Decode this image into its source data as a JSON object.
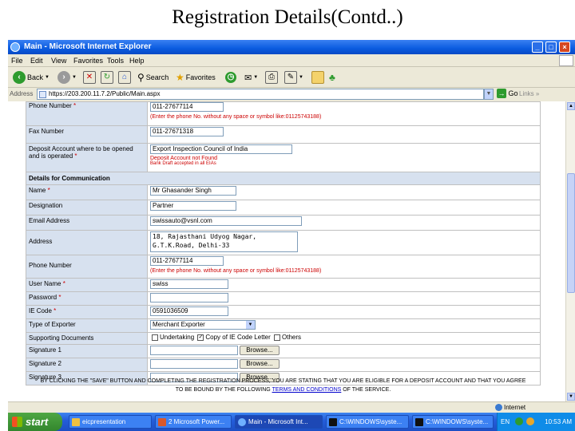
{
  "slide": {
    "title": "Registration Details(Contd..)"
  },
  "window": {
    "title": "Main - Microsoft Internet Explorer",
    "minimize": "_",
    "maximize": "□",
    "close": "×"
  },
  "menu": [
    "File",
    "Edit",
    "View",
    "Favorites",
    "Tools",
    "Help"
  ],
  "toolbar": {
    "back": "Back",
    "search": "Search",
    "favorites": "Favorites"
  },
  "address": {
    "label": "Address",
    "url": "https://203.200.11.7.2/Public/Main.aspx",
    "go": "Go",
    "links": "Links"
  },
  "form": {
    "rows_top": [
      {
        "label": "Phone Number",
        "required": "*",
        "value": "011-27677114",
        "hint": "(Enter the phone No. without any space or symbol like:01125743188)"
      },
      {
        "label": "Fax Number",
        "required": "",
        "value": "011-27671318",
        "hint": ""
      },
      {
        "label": "Deposit Account where to be opened and is operated",
        "required": "*",
        "value": "Export Inspection Council of India",
        "hint": "Deposit Account not Found",
        "hint2": "Bank Draft accepted in all EIAs"
      }
    ],
    "section": "Details for Communication",
    "name": {
      "label": "Name",
      "required": "*",
      "value": "Mr Ghasander Singh"
    },
    "designation": {
      "label": "Designation",
      "value": "Partner"
    },
    "email": {
      "label": "Email Address",
      "value": "swissauto@vsnl.com"
    },
    "address": {
      "label": "Address",
      "line1": "18, Rajasthani Udyog Nagar,",
      "line2": "G.T.K.Road, Delhi-33"
    },
    "phone": {
      "label": "Phone Number",
      "value": "011-27677114",
      "hint": "(Enter the phone No. without any space or symbol like:01125743188)"
    },
    "username": {
      "label": "User Name",
      "required": "*",
      "value": "swiss"
    },
    "password": {
      "label": "Password",
      "required": "*",
      "value": ""
    },
    "iecode": {
      "label": "IE Code",
      "required": "*",
      "value": "0591036509"
    },
    "exporter": {
      "label": "Type of Exporter",
      "value": "Merchant Exporter"
    },
    "docs": {
      "label": "Supporting Documents",
      "opt1": "Undertaking",
      "opt2": "Copy of IE Code Letter",
      "opt3": "Others",
      "checkmark": "✓"
    },
    "sig1": {
      "label": "Signature 1",
      "button": "Browse..."
    },
    "sig2": {
      "label": "Signature 2",
      "button": "Browse..."
    },
    "sig3": {
      "label": "Signature 3",
      "button": "Browse..."
    }
  },
  "note": {
    "line1": "BY CLICKING THE \"SAVE\" BUTTON AND COMPLETING THE REGISTRATION PROCESS, YOU ARE STATING THAT YOU ARE ELIGIBLE FOR A DEPOSIT ACCOUNT AND THAT YOU AGREE",
    "line2a": "TO BE BOUND BY THE FOLLOWING ",
    "link": "TERMS AND CONDITIONS",
    "line2b": " OF THE SERVICE."
  },
  "status": {
    "zone": "Internet"
  },
  "taskbar": {
    "start": "start",
    "tasks": [
      "eicpresentation",
      "2 Microsoft Power...",
      "Main - Microsoft Int...",
      "C:\\WINDOWS\\syste...",
      "C:\\WINDOWS\\syste..."
    ],
    "lang": "EN",
    "clock": "10:53 AM"
  }
}
